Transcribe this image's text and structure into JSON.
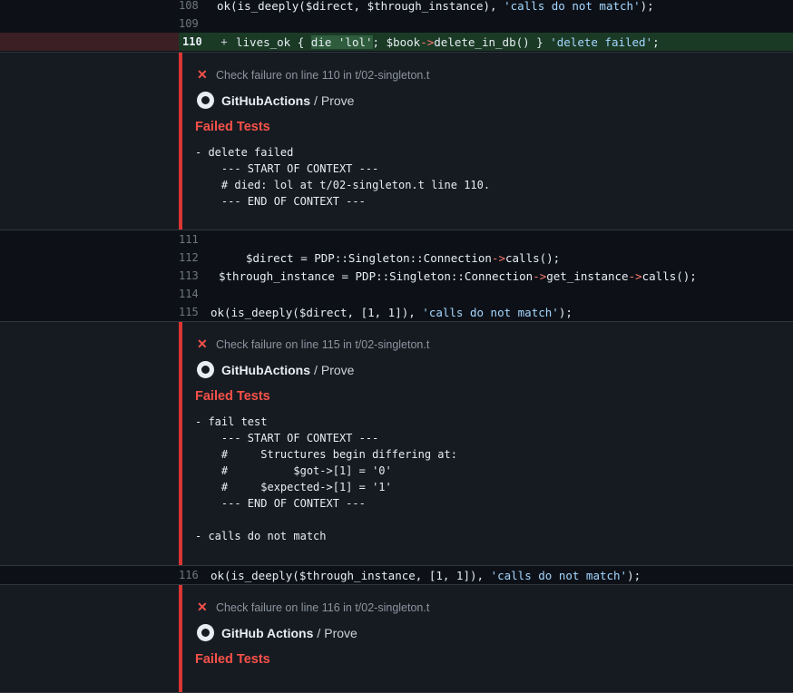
{
  "lines": {
    "l108": {
      "num": "108",
      "pre": "ok(is_deeply($direct, $through_instance), ",
      "str": "'calls do not match'",
      "post": ");"
    },
    "l109": {
      "num": "109"
    },
    "l110": {
      "num": "110",
      "marker": "+",
      "pre": "lives_ok { ",
      "hl": "die 'lol'",
      "mid": "; $book",
      "op": "->",
      "post": "delete_in_db() } ",
      "str": "'delete failed'",
      "end": ";"
    },
    "l111": {
      "num": "111"
    },
    "l112": {
      "num": "112",
      "pre": "$direct = PDP::Singleton::Connection",
      "op": "->",
      "post": "calls();"
    },
    "l113": {
      "num": "113",
      "pre": "$through_instance = PDP::Singleton::Connection",
      "op1": "->",
      "mid": "get_instance",
      "op2": "->",
      "post": "calls();"
    },
    "l114": {
      "num": "114"
    },
    "l115": {
      "num": "115",
      "pre": "ok(is_deeply($direct, [1, 1]), ",
      "str": "'calls do not match'",
      "post": ");"
    },
    "l116": {
      "num": "116",
      "pre": "ok(is_deeply($through_instance, [1, 1]), ",
      "str": "'calls do not match'",
      "post": ");"
    }
  },
  "annotations": [
    {
      "head": "Check failure on line 110 in t/02-singleton.t",
      "bot": "GitHubActions",
      "sep": "/",
      "job": "Prove",
      "title": "Failed Tests",
      "message": "- delete failed\n    --- START OF CONTEXT ---\n    # died: lol at t/02-singleton.t line 110.\n    --- END OF CONTEXT ---"
    },
    {
      "head": "Check failure on line 115 in t/02-singleton.t",
      "bot": "GitHubActions",
      "sep": "/",
      "job": "Prove",
      "title": "Failed Tests",
      "message": "- fail test\n    --- START OF CONTEXT ---\n    #     Structures begin differing at:\n    #          $got->[1] = '0'\n    #     $expected->[1] = '1'\n    --- END OF CONTEXT ---\n\n- calls do not match"
    },
    {
      "head": "Check failure on line 116 in t/02-singleton.t",
      "bot": "GitHub Actions",
      "sep": "/",
      "job": "Prove",
      "title": "Failed Tests"
    }
  ],
  "colors": {
    "error": "#f85149",
    "added_bg": "#1b3a26",
    "removed_gutter": "#3b1f24"
  }
}
